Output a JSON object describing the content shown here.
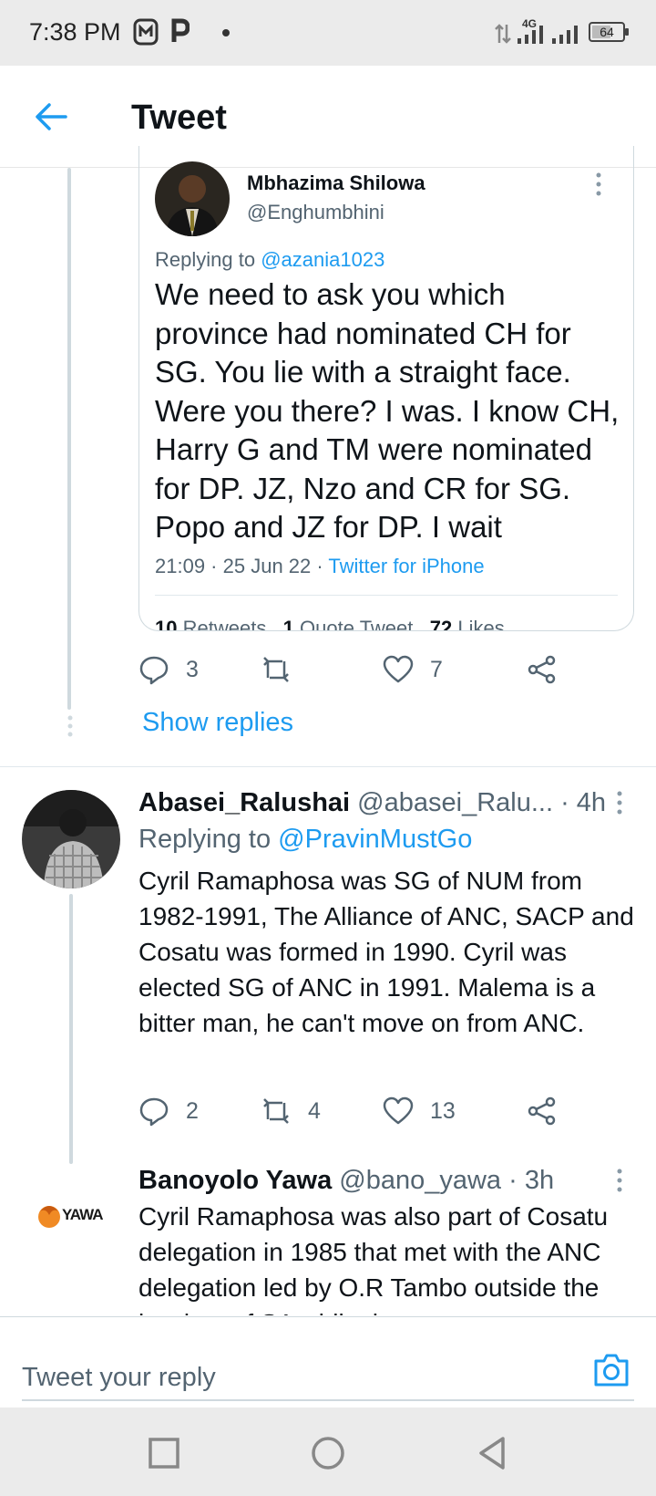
{
  "status_bar": {
    "time": "7:38 PM",
    "network": "4G",
    "battery": "64",
    "battery_level": 0.64
  },
  "header": {
    "title": "Tweet"
  },
  "quoted_tweet": {
    "author_name": "Mbhazima Shilowa",
    "author_handle": "@Enghumbhini",
    "replying_prefix": "Replying to",
    "replying_to": "@azania1023",
    "text": "We need to ask you which province had nominated CH for SG. You lie with a straight face. Were you there? I was. I know CH, Harry G and TM were nominated for DP. JZ, Nzo and CR for SG. Popo and JZ for DP. I wait",
    "time": "21:09",
    "date": "25 Jun 22",
    "source": "Twitter for iPhone",
    "retweets_count": "10",
    "retweets_label": "Retweets",
    "quote_count": "1",
    "quote_label": "Quote Tweet",
    "likes_count": "72",
    "likes_label": "Likes"
  },
  "quoted_actions": {
    "replies": "3",
    "retweets": "",
    "likes": "7"
  },
  "show_replies": "Show replies",
  "tweets": [
    {
      "name": "Abasei_Ralushai",
      "handle": "@abasei_Ralu...",
      "time": "· 4h",
      "replying_prefix": "Replying to",
      "replying_to": "@PravinMustGo",
      "text": "Cyril Ramaphosa was SG of NUM from 1982-1991, The Alliance of ANC, SACP and Cosatu was formed in 1990. Cyril was elected SG of ANC in 1991. Malema is a bitter man, he can't move on from ANC.",
      "replies": "2",
      "retweets": "4",
      "likes": "13"
    },
    {
      "name": "Banoyolo Yawa",
      "handle": "@bano_yawa",
      "time": "· 3h",
      "avatar_logo": "YAWA",
      "text": "Cyril Ramaphosa was also part of Cosatu delegation in 1985 that met with the ANC delegation led by O.R Tambo outside the borders of SA while the"
    }
  ],
  "reply_bar": {
    "placeholder": "Tweet your reply"
  },
  "colors": {
    "accent": "#1d9bf0",
    "secondary_text": "#536471",
    "primary_text": "#0f1419"
  }
}
